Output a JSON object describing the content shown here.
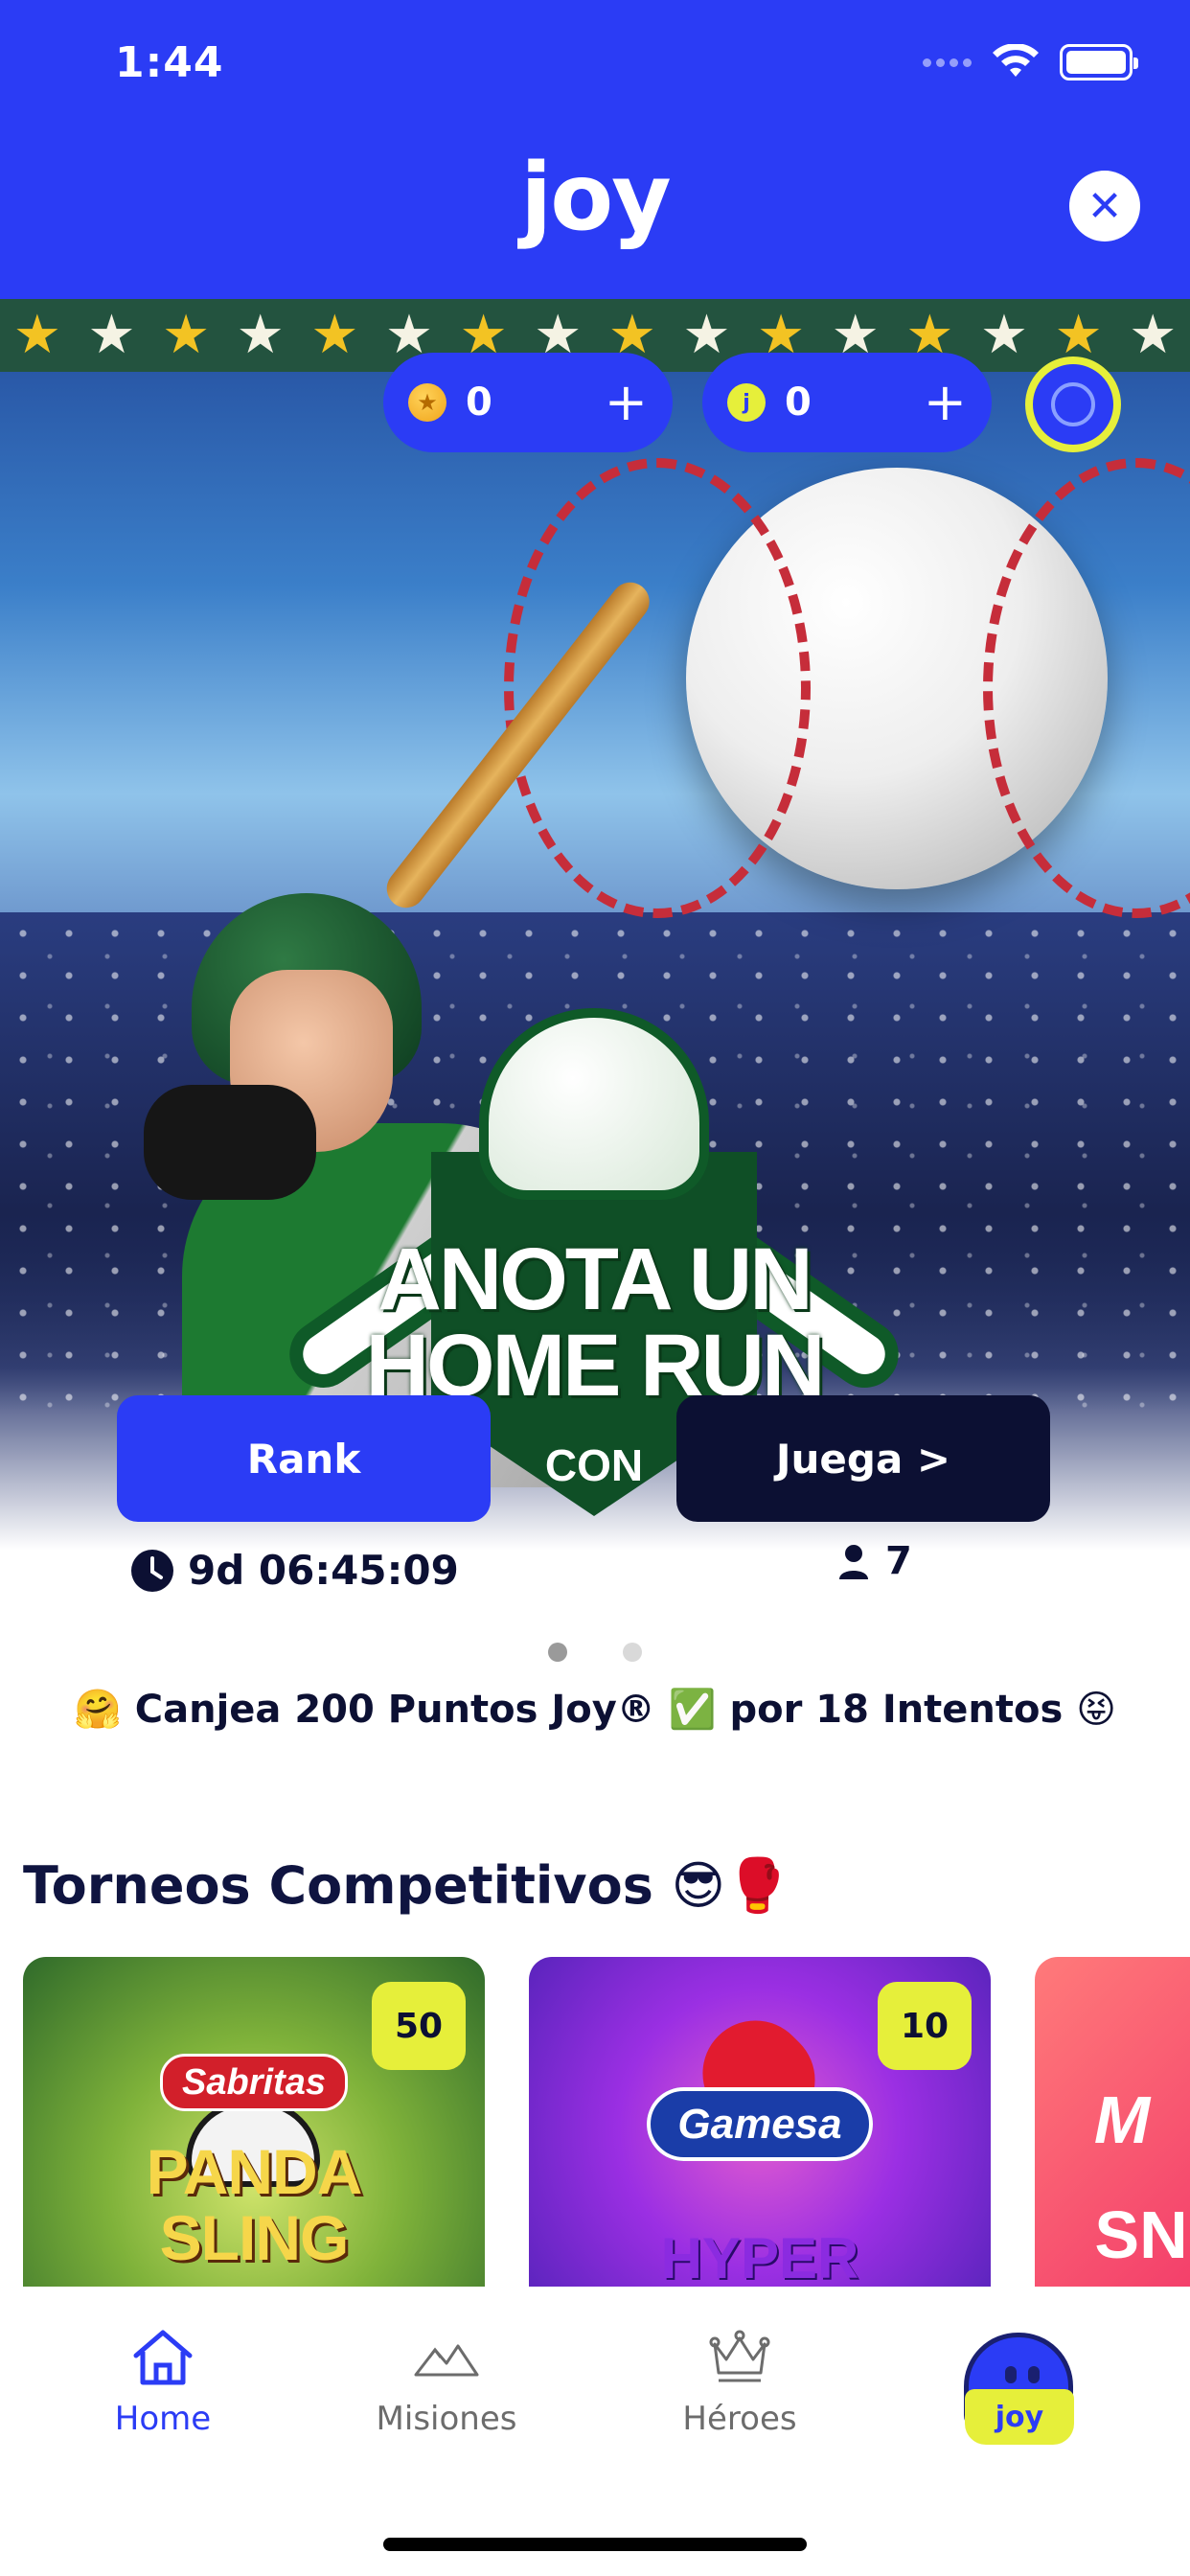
{
  "status_bar": {
    "time": "1:44"
  },
  "header": {
    "logo": "joy",
    "close_icon": "close-icon"
  },
  "balances": {
    "coins": "0",
    "joy_points": "0",
    "add_symbol": "+"
  },
  "banner": {
    "title_line1": "ANOTA UN",
    "title_line2": "HOME RUN",
    "title_line3": "CON",
    "rank_button": "Rank",
    "play_button": "Juega >",
    "timer": "9d 06:45:09",
    "players_count": "7",
    "carousel_pages": 2,
    "carousel_active_index": 0
  },
  "promo": {
    "text": "🤗 Canjea 200 Puntos Joy® ✅ por 18 Intentos 😝"
  },
  "tournaments": {
    "title": "Torneos Competitivos 😎🥊",
    "cards": [
      {
        "badge": "50",
        "brand": "Sabritas",
        "game_line1": "PANDA",
        "game_line2": "SLING"
      },
      {
        "badge": "10",
        "brand": "Gamesa",
        "game_line1": "HYPER"
      },
      {
        "brand_partial": "M",
        "game_partial": "SN"
      }
    ]
  },
  "bottom_nav": {
    "items": [
      {
        "label": "Home",
        "icon": "home-icon",
        "active": true
      },
      {
        "label": "Misiones",
        "icon": "mountains-icon",
        "active": false
      },
      {
        "label": "Héroes",
        "icon": "crown-icon",
        "active": false
      }
    ],
    "mascot_label": "joy"
  },
  "colors": {
    "brand_blue": "#2b3cf5",
    "accent_yellow": "#e6ef3a",
    "dark_navy": "#0c1033"
  }
}
